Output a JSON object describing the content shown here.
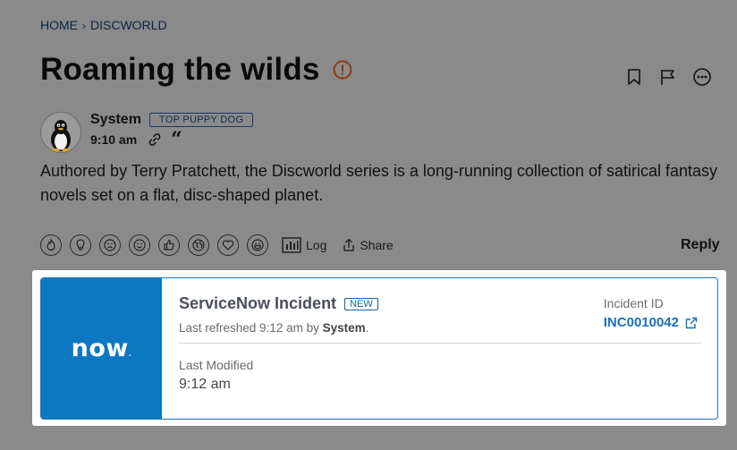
{
  "breadcrumb": {
    "home": "HOME",
    "separator": "›",
    "current": "DISCWORLD"
  },
  "page_title": "Roaming the wilds",
  "post": {
    "author": "System",
    "rank": "TOP PUPPY DOG",
    "time": "9:10 am",
    "body": "Authored by Terry Pratchett, the Discworld series is a long-running collection of satirical fantasy novels set on a flat, disc-shaped planet."
  },
  "actions": {
    "log": "Log",
    "share": "Share",
    "reply": "Reply"
  },
  "reactions": [
    "fire-reaction",
    "lightbulb-reaction",
    "frown-reaction",
    "smile-reaction",
    "thumbs-up-reaction",
    "globe-reaction",
    "heart-reaction",
    "grin-reaction"
  ],
  "card": {
    "logo": "now",
    "logo_dot": ".",
    "title": "ServiceNow Incident",
    "badge": "NEW",
    "refreshed_prefix": "Last refreshed 9:12 am by ",
    "refreshed_user": "System",
    "refreshed_suffix": ".",
    "incident_label": "Incident ID",
    "incident_id": "INC0010042",
    "last_modified_label": "Last Modified",
    "last_modified_value": "9:12 am"
  },
  "colors": {
    "accent": "#0d78c2",
    "link": "#1a70b8",
    "overlay": "#8a8a8a",
    "alert": "#8a3a12"
  }
}
